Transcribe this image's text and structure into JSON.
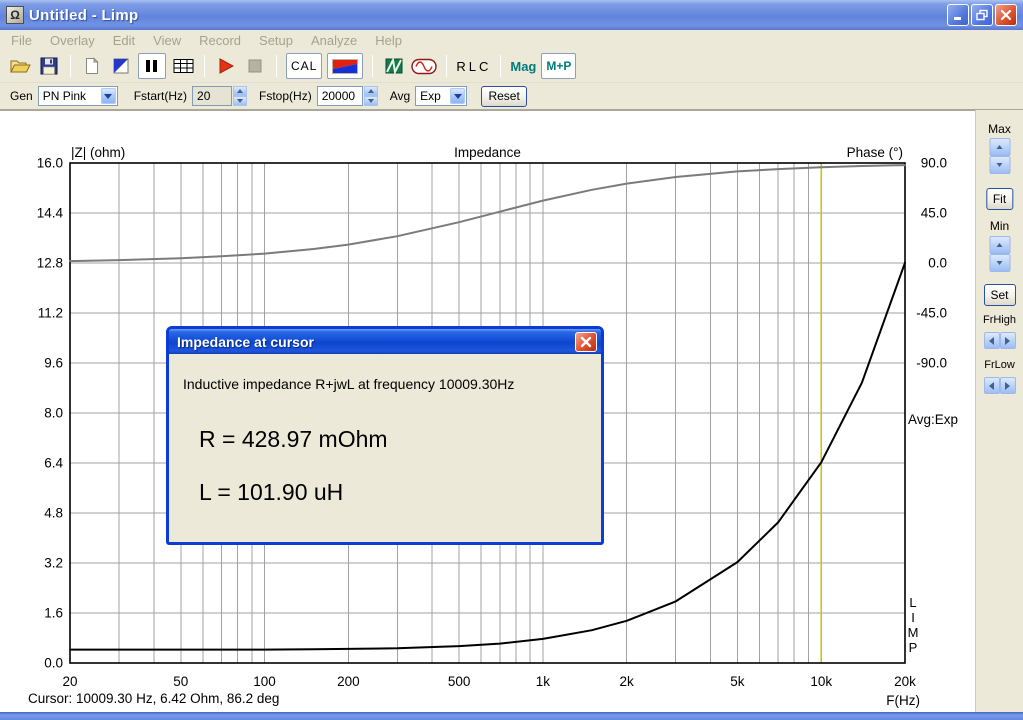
{
  "window": {
    "title": "Untitled - Limp"
  },
  "icons": {
    "app_glyph": "Ω"
  },
  "menu": {
    "items": [
      "File",
      "Overlay",
      "Edit",
      "View",
      "Record",
      "Setup",
      "Analyze",
      "Help"
    ]
  },
  "toolbar": {
    "cal": "CAL",
    "rlc": "RLC",
    "mag": "Mag",
    "mp": "M+P",
    "accent_teal": "#007C7C"
  },
  "params": {
    "gen_label": "Gen",
    "gen_value": "PN Pink",
    "fstart_label": "Fstart(Hz)",
    "fstart_value": "20",
    "fstop_label": "Fstop(Hz)",
    "fstop_value": "20000",
    "avg_label": "Avg",
    "avg_value": "Exp",
    "reset_label": "Reset"
  },
  "side_panel": {
    "max": "Max",
    "fit": "Fit",
    "min": "Min",
    "set": "Set",
    "frhigh": "FrHigh",
    "frlow": "FrLow"
  },
  "overlays": {
    "avg_mode": "Avg:Exp",
    "watermark": "LIMP"
  },
  "dialog": {
    "title": "Impedance at cursor",
    "message": "Inductive impedance R+jwL at frequency 10009.30Hz",
    "r_value": "R = 428.97 mOhm",
    "l_value": "L = 101.90 uH"
  },
  "status": {
    "cursor_text": "Cursor: 10009.30 Hz, 6.42 Ohm, 86.2 deg"
  },
  "chart_data": {
    "type": "line",
    "title": "Impedance",
    "x_label": "F(Hz)",
    "x_scale": "log",
    "x_range": [
      20,
      20000
    ],
    "x_ticks": [
      {
        "f": 20,
        "label": "20"
      },
      {
        "f": 50,
        "label": "50"
      },
      {
        "f": 100,
        "label": "100"
      },
      {
        "f": 200,
        "label": "200"
      },
      {
        "f": 500,
        "label": "500"
      },
      {
        "f": 1000,
        "label": "1k"
      },
      {
        "f": 2000,
        "label": "2k"
      },
      {
        "f": 5000,
        "label": "5k"
      },
      {
        "f": 10000,
        "label": "10k"
      },
      {
        "f": 20000,
        "label": "20k"
      }
    ],
    "y_left_label": "|Z| (ohm)",
    "y_left_range": [
      0,
      16
    ],
    "y_left_ticks": [
      "16.0",
      "14.4",
      "12.8",
      "11.2",
      "9.6",
      "8.0",
      "6.4",
      "4.8",
      "3.2",
      "1.6",
      "0.0"
    ],
    "y_right_label": "Phase (°)",
    "y_right_ticks": [
      "90.0",
      "45.0",
      "0.0",
      "-45.0",
      "-90.0"
    ],
    "y_right_deg_per_division": 45,
    "grid_on": true,
    "grid_color": "#A2A2A2",
    "cursor": {
      "f_hz": 10009.3,
      "z_ohm": 6.42,
      "phase_deg": 86.2,
      "color": "#C9C400"
    },
    "series": [
      {
        "name": "impedance-magnitude",
        "axis": "left",
        "color": "#000000",
        "f": [
          20,
          30,
          50,
          70,
          100,
          150,
          200,
          300,
          500,
          700,
          1000,
          1500,
          2000,
          3000,
          5000,
          7000,
          10000,
          14000,
          20000
        ],
        "v": [
          0.43,
          0.43,
          0.43,
          0.43,
          0.43,
          0.44,
          0.45,
          0.47,
          0.54,
          0.62,
          0.77,
          1.05,
          1.35,
          1.97,
          3.23,
          4.5,
          6.42,
          8.97,
          12.81
        ]
      },
      {
        "name": "phase",
        "axis": "right",
        "color": "#7B7B7B",
        "f": [
          20,
          30,
          50,
          70,
          100,
          150,
          200,
          300,
          500,
          700,
          1000,
          1500,
          2000,
          3000,
          5000,
          7000,
          10000,
          14000,
          20000
        ],
        "v": [
          1.7,
          2.6,
          4.3,
          6.0,
          8.5,
          12.6,
          16.6,
          24.1,
          36.7,
          46.2,
          56.2,
          65.9,
          71.5,
          77.4,
          82.4,
          84.5,
          86.2,
          87.3,
          88.1
        ]
      }
    ]
  }
}
